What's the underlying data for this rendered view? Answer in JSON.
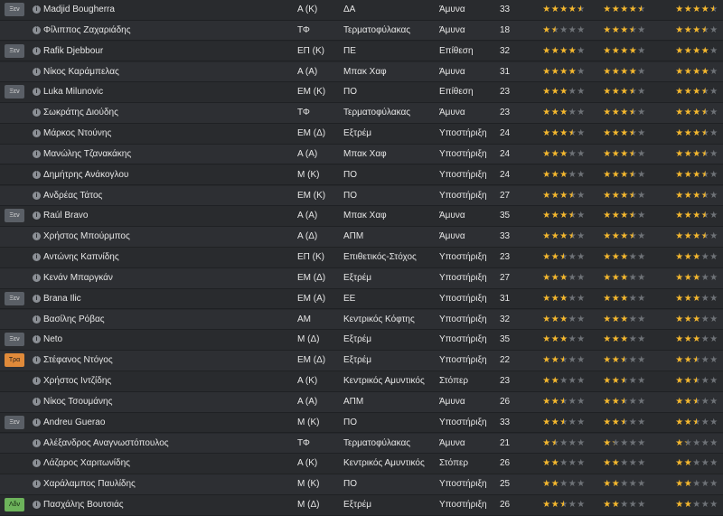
{
  "rows": [
    {
      "badge": "Ξεν",
      "badge_color": "gray",
      "name": "Madjid Bougherra",
      "pos": "Α (Κ)",
      "role": "ΔΑ",
      "duty": "Άμυνα",
      "age": "33",
      "r1": 4.5,
      "r2": 4.5,
      "r3": 4.5
    },
    {
      "badge": "",
      "badge_color": "",
      "name": "Φίλιππος Ζαχαριάδης",
      "pos": "ΤΦ",
      "role": "Τερματοφύλακας",
      "duty": "Άμυνα",
      "age": "18",
      "r1": 1.5,
      "r2": 3.5,
      "r3": 3.5
    },
    {
      "badge": "Ξεν",
      "badge_color": "gray",
      "name": "Rafik Djebbour",
      "pos": "ΕΠ (Κ)",
      "role": "ΠΕ",
      "duty": "Επίθεση",
      "age": "32",
      "r1": 4,
      "r2": 4,
      "r3": 4
    },
    {
      "badge": "",
      "badge_color": "",
      "name": "Νίκος Καράμπελας",
      "pos": "Α (Α)",
      "role": "Μπακ Χαφ",
      "duty": "Άμυνα",
      "age": "31",
      "r1": 4,
      "r2": 4,
      "r3": 4
    },
    {
      "badge": "Ξεν",
      "badge_color": "gray",
      "name": "Luka Milunovic",
      "pos": "ΕΜ (Κ)",
      "role": "ΠΟ",
      "duty": "Επίθεση",
      "age": "23",
      "r1": 3,
      "r2": 3.5,
      "r3": 3.5
    },
    {
      "badge": "",
      "badge_color": "",
      "name": "Σωκράτης Διούδης",
      "pos": "ΤΦ",
      "role": "Τερματοφύλακας",
      "duty": "Άμυνα",
      "age": "23",
      "r1": 3,
      "r2": 3.5,
      "r3": 3.5
    },
    {
      "badge": "",
      "badge_color": "",
      "name": "Μάρκος Ντούνης",
      "pos": "ΕΜ (Δ)",
      "role": "Εξτρέμ",
      "duty": "Υποστήριξη",
      "age": "24",
      "r1": 3.5,
      "r2": 3.5,
      "r3": 3.5
    },
    {
      "badge": "",
      "badge_color": "",
      "name": "Μανώλης Τζανακάκης",
      "pos": "Α (Α)",
      "role": "Μπακ Χαφ",
      "duty": "Υποστήριξη",
      "age": "24",
      "r1": 3,
      "r2": 3.5,
      "r3": 3.5
    },
    {
      "badge": "",
      "badge_color": "",
      "name": "Δημήτρης Ανάκογλου",
      "pos": "Μ (Κ)",
      "role": "ΠΟ",
      "duty": "Υποστήριξη",
      "age": "24",
      "r1": 3,
      "r2": 3.5,
      "r3": 3.5
    },
    {
      "badge": "",
      "badge_color": "",
      "name": "Ανδρέας Τάτος",
      "pos": "ΕΜ (Κ)",
      "role": "ΠΟ",
      "duty": "Υποστήριξη",
      "age": "27",
      "r1": 3.5,
      "r2": 3.5,
      "r3": 3.5
    },
    {
      "badge": "Ξεν",
      "badge_color": "gray",
      "name": "Raúl Bravo",
      "pos": "Α (Α)",
      "role": "Μπακ Χαφ",
      "duty": "Άμυνα",
      "age": "35",
      "r1": 3.5,
      "r2": 3.5,
      "r3": 3.5
    },
    {
      "badge": "",
      "badge_color": "",
      "name": "Χρήστος Μπούρμπος",
      "pos": "Α (Δ)",
      "role": "ΑΠΜ",
      "duty": "Άμυνα",
      "age": "33",
      "r1": 3.5,
      "r2": 3.5,
      "r3": 3.5
    },
    {
      "badge": "",
      "badge_color": "",
      "name": "Αντώνης Καπνίδης",
      "pos": "ΕΠ (Κ)",
      "role": "Επιθετικός-Στόχος",
      "duty": "Υποστήριξη",
      "age": "23",
      "r1": 2.5,
      "r2": 3,
      "r3": 3
    },
    {
      "badge": "",
      "badge_color": "",
      "name": "Κενάν Μπαργκάν",
      "pos": "ΕΜ (Δ)",
      "role": "Εξτρέμ",
      "duty": "Υποστήριξη",
      "age": "27",
      "r1": 3,
      "r2": 3,
      "r3": 3
    },
    {
      "badge": "Ξεν",
      "badge_color": "gray",
      "name": "Brana Ilic",
      "pos": "ΕΜ (Α)",
      "role": "ΕΕ",
      "duty": "Υποστήριξη",
      "age": "31",
      "r1": 3,
      "r2": 3,
      "r3": 3
    },
    {
      "badge": "",
      "badge_color": "",
      "name": "Βασίλης Ρόβας",
      "pos": "ΑΜ",
      "role": "Κεντρικός Κόφτης",
      "duty": "Υποστήριξη",
      "age": "32",
      "r1": 3,
      "r2": 3,
      "r3": 3
    },
    {
      "badge": "Ξεν",
      "badge_color": "gray",
      "name": "Neto",
      "pos": "Μ (Δ)",
      "role": "Εξτρέμ",
      "duty": "Υποστήριξη",
      "age": "35",
      "r1": 3,
      "r2": 3,
      "r3": 3
    },
    {
      "badge": "Τρα",
      "badge_color": "orange",
      "name": "Στέφανος Ντόγος",
      "pos": "ΕΜ (Δ)",
      "role": "Εξτρέμ",
      "duty": "Υποστήριξη",
      "age": "22",
      "r1": 2.5,
      "r2": 2.5,
      "r3": 2.5
    },
    {
      "badge": "",
      "badge_color": "",
      "name": "Χρήστος Ιντζίδης",
      "pos": "Α (Κ)",
      "role": "Κεντρικός Αμυντικός",
      "duty": "Στόπερ",
      "age": "23",
      "r1": 2,
      "r2": 2.5,
      "r3": 2.5
    },
    {
      "badge": "",
      "badge_color": "",
      "name": "Νίκος Τσουμάνης",
      "pos": "Α (Α)",
      "role": "ΑΠΜ",
      "duty": "Άμυνα",
      "age": "26",
      "r1": 2.5,
      "r2": 2.5,
      "r3": 2.5
    },
    {
      "badge": "Ξεν",
      "badge_color": "gray",
      "name": "Andreu Guerao",
      "pos": "Μ (Κ)",
      "role": "ΠΟ",
      "duty": "Υποστήριξη",
      "age": "33",
      "r1": 2.5,
      "r2": 2.5,
      "r3": 2.5
    },
    {
      "badge": "",
      "badge_color": "",
      "name": "Αλέξανδρος Αναγνωστόπουλος",
      "pos": "ΤΦ",
      "role": "Τερματοφύλακας",
      "duty": "Άμυνα",
      "age": "21",
      "r1": 1.5,
      "r2": 1.3,
      "r3": 1.3
    },
    {
      "badge": "",
      "badge_color": "",
      "name": "Λάζαρος Χαριτωνίδης",
      "pos": "Α (Κ)",
      "role": "Κεντρικός Αμυντικός",
      "duty": "Στόπερ",
      "age": "26",
      "r1": 2,
      "r2": 2,
      "r3": 2
    },
    {
      "badge": "",
      "badge_color": "",
      "name": "Χαράλαμπος Παυλίδης",
      "pos": "Μ (Κ)",
      "role": "ΠΟ",
      "duty": "Υποστήριξη",
      "age": "25",
      "r1": 2,
      "r2": 2,
      "r3": 2
    },
    {
      "badge": "Λδν",
      "badge_color": "green",
      "name": "Πασχάλης Βουτσιάς",
      "pos": "Μ (Δ)",
      "role": "Εξτρέμ",
      "duty": "Υποστήριξη",
      "age": "26",
      "r1": 2.5,
      "r2": 2,
      "r3": 2
    }
  ],
  "info_icon": "i",
  "star_glyph": "★",
  "colors": {
    "star_on": "#f5b82e",
    "star_off": "#6e7277",
    "badge_gray": "#5a5f66",
    "badge_orange": "#e08a3a",
    "badge_green": "#6db35b"
  }
}
